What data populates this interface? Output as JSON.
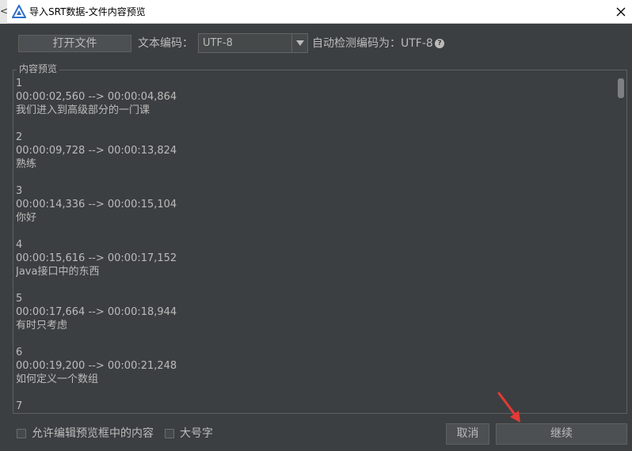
{
  "window": {
    "title": "导入SRT数据-文件内容预览",
    "side_glyph": "<"
  },
  "toolbar": {
    "open_file_label": "打开文件",
    "encoding_label": "文本编码：",
    "encoding_value": "UTF-8",
    "detected_text": "自动检测编码为：UTF-8",
    "help_icon_text": "?"
  },
  "preview": {
    "legend": "内容预览",
    "content": "1\n00:00:02,560 --> 00:00:04,864\n我们进入到高级部分的一门课\n\n2\n00:00:09,728 --> 00:00:13,824\n熟练\n\n3\n00:00:14,336 --> 00:00:15,104\n你好\n\n4\n00:00:15,616 --> 00:00:17,152\nJava接口中的东西\n\n5\n00:00:17,664 --> 00:00:18,944\n有时只考虑\n\n6\n00:00:19,200 --> 00:00:21,248\n如何定义一个数组\n\n7"
  },
  "options": {
    "allow_edit_label": "允许编辑预览框中的内容",
    "allow_edit_checked": false,
    "large_font_label": "大号字",
    "large_font_checked": false
  },
  "footer": {
    "cancel_label": "取消",
    "continue_label": "继续"
  },
  "colors": {
    "background": "#3c3f41",
    "text": "#bbbbbb",
    "annotation_arrow": "#e53935",
    "app_icon": "#2f6fc9"
  },
  "icons": {
    "app": "triangle-logo-icon",
    "close": "close-icon",
    "help": "help-icon",
    "dropdown": "chevron-down-icon",
    "annotation": "red-arrow-icon"
  }
}
